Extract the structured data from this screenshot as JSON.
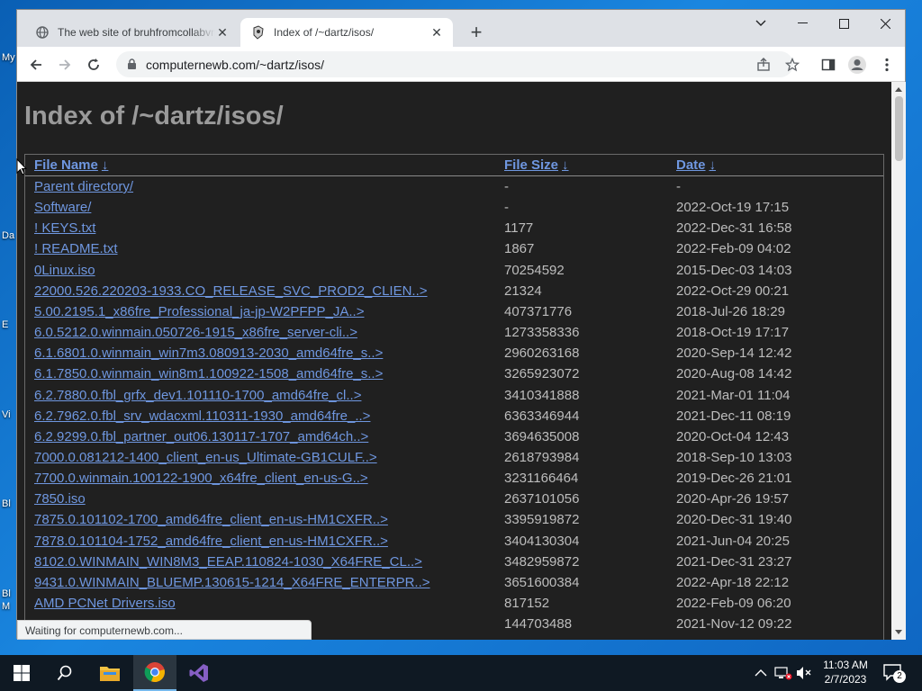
{
  "browser": {
    "tabs": [
      {
        "title": "The web site of bruhfromcollabvm",
        "active": false
      },
      {
        "title": "Index of /~dartz/isos/",
        "active": true
      }
    ],
    "address": "computernewb.com/~dartz/isos/",
    "status": "Waiting for computernewb.com..."
  },
  "page": {
    "heading": "Index of /~dartz/isos/",
    "columns": {
      "name": "File Name",
      "size": "File Size",
      "date": "Date",
      "sort_arrow": "↓"
    },
    "rows": [
      {
        "name": "Parent directory/",
        "size": "-",
        "date": "-"
      },
      {
        "name": "Software/",
        "size": "-",
        "date": "2022-Oct-19 17:15"
      },
      {
        "name": "! KEYS.txt",
        "size": "1177",
        "date": "2022-Dec-31 16:58"
      },
      {
        "name": "! README.txt",
        "size": "1867",
        "date": "2022-Feb-09 04:02"
      },
      {
        "name": "0Linux.iso",
        "size": "70254592",
        "date": "2015-Dec-03 14:03"
      },
      {
        "name": "22000.526.220203-1933.CO_RELEASE_SVC_PROD2_CLIEN..>",
        "size": "21324",
        "date": "2022-Oct-29 00:21"
      },
      {
        "name": "5.00.2195.1_x86fre_Professional_ja-jp-W2PFPP_JA..>",
        "size": "407371776",
        "date": "2018-Jul-26 18:29"
      },
      {
        "name": "6.0.5212.0.winmain.050726-1915_x86fre_server-cli..>",
        "size": "1273358336",
        "date": "2018-Oct-19 17:17"
      },
      {
        "name": "6.1.6801.0.winmain_win7m3.080913-2030_amd64fre_s..>",
        "size": "2960263168",
        "date": "2020-Sep-14 12:42"
      },
      {
        "name": "6.1.7850.0.winmain_win8m1.100922-1508_amd64fre_s..>",
        "size": "3265923072",
        "date": "2020-Aug-08 14:42"
      },
      {
        "name": "6.2.7880.0.fbl_grfx_dev1.101110-1700_amd64fre_cl..>",
        "size": "3410341888",
        "date": "2021-Mar-01 11:04"
      },
      {
        "name": "6.2.7962.0.fbl_srv_wdacxml.110311-1930_amd64fre_..>",
        "size": "6363346944",
        "date": "2021-Dec-11 08:19"
      },
      {
        "name": "6.2.9299.0.fbl_partner_out06.130117-1707_amd64ch..>",
        "size": "3694635008",
        "date": "2020-Oct-04 12:43"
      },
      {
        "name": "7000.0.081212-1400_client_en-us_Ultimate-GB1CULF..>",
        "size": "2618793984",
        "date": "2018-Sep-10 13:03"
      },
      {
        "name": "7700.0.winmain.100122-1900_x64fre_client_en-us-G..>",
        "size": "3231166464",
        "date": "2019-Dec-26 21:01"
      },
      {
        "name": "7850.iso",
        "size": "2637101056",
        "date": "2020-Apr-26 19:57"
      },
      {
        "name": "7875.0.101102-1700_amd64fre_client_en-us-HM1CXFR..>",
        "size": "3395919872",
        "date": "2020-Dec-31 19:40"
      },
      {
        "name": "7878.0.101104-1752_amd64fre_client_en-us-HM1CXFR..>",
        "size": "3404130304",
        "date": "2021-Jun-04 20:25"
      },
      {
        "name": "8102.0.WINMAIN_WIN8M3_EEAP.110824-1030_X64FRE_CL..>",
        "size": "3482959872",
        "date": "2021-Dec-31 23:27"
      },
      {
        "name": "9431.0.WINMAIN_BLUEMP.130615-1214_X64FRE_ENTERPR..>",
        "size": "3651600384",
        "date": "2022-Apr-18 22:12"
      },
      {
        "name": "AMD PCNet Drivers.iso",
        "size": "817152",
        "date": "2022-Feb-09 06:20"
      },
      {
        "name": "",
        "size": "144703488",
        "date": "2021-Nov-12 09:22"
      }
    ]
  },
  "taskbar": {
    "time": "11:03 AM",
    "date": "2/7/2023",
    "notification_count": "2"
  },
  "desktop_labels": [
    "My",
    "Da",
    "E",
    "Vi",
    "Bl",
    "Bl",
    "M"
  ]
}
